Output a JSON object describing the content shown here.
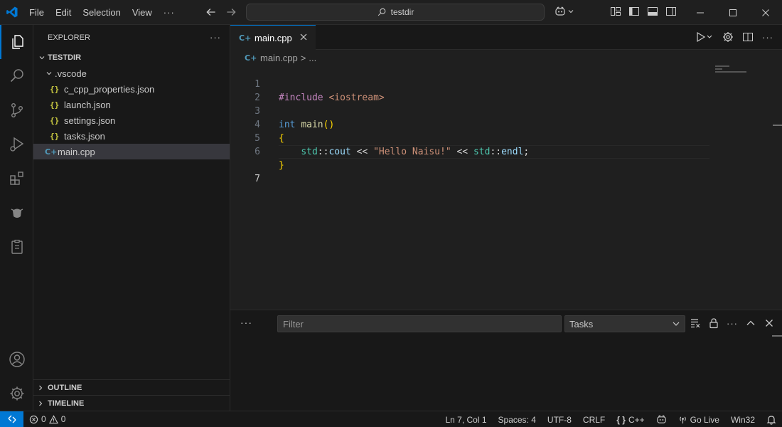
{
  "app": {
    "accent": "#0078d4"
  },
  "menu": {
    "file": "File",
    "edit": "Edit",
    "selection": "Selection",
    "view": "View",
    "more": "···"
  },
  "command_center": {
    "text": "testdir"
  },
  "sidebar": {
    "title": "EXPLORER",
    "more": "···",
    "root": "TESTDIR",
    "folder": ".vscode",
    "files": [
      {
        "name": "c_cpp_properties.json",
        "icon": "{}"
      },
      {
        "name": "launch.json",
        "icon": "{}"
      },
      {
        "name": "settings.json",
        "icon": "{}"
      },
      {
        "name": "tasks.json",
        "icon": "{}"
      }
    ],
    "main_file": "main.cpp",
    "main_icon": "C+",
    "outline": "OUTLINE",
    "timeline": "TIMELINE"
  },
  "editor": {
    "tab_label": "main.cpp",
    "tab_icon": "C+",
    "breadcrumb_file": "main.cpp",
    "breadcrumb_sep": ">",
    "breadcrumb_more": "...",
    "line_numbers": [
      "1",
      "2",
      "3",
      "4",
      "5",
      "6",
      "7"
    ],
    "code": {
      "l1_directive": "#include",
      "l1_header": "<iostream>",
      "l3_type": "int",
      "l3_func": "main",
      "l3_parens": "()",
      "l4_brace": "{",
      "l5_ns1": "std",
      "l5_sep1": "::",
      "l5_cout": "cout",
      "l5_op1": "<<",
      "l5_string": "\"Hello Naisu!\"",
      "l5_op2": "<<",
      "l5_ns2": "std",
      "l5_sep2": "::",
      "l5_endl": "endl",
      "l5_semi": ";",
      "l6_brace": "}"
    }
  },
  "panel": {
    "more": "···",
    "filter_placeholder": "Filter",
    "select_value": "Tasks"
  },
  "statusbar": {
    "errors": "0",
    "warnings": "0",
    "position": "Ln 7, Col 1",
    "spaces": "Spaces: 4",
    "encoding": "UTF-8",
    "eol": "CRLF",
    "language_braces": "{ }",
    "language": "C++",
    "golive": "Go Live",
    "platform": "Win32"
  }
}
